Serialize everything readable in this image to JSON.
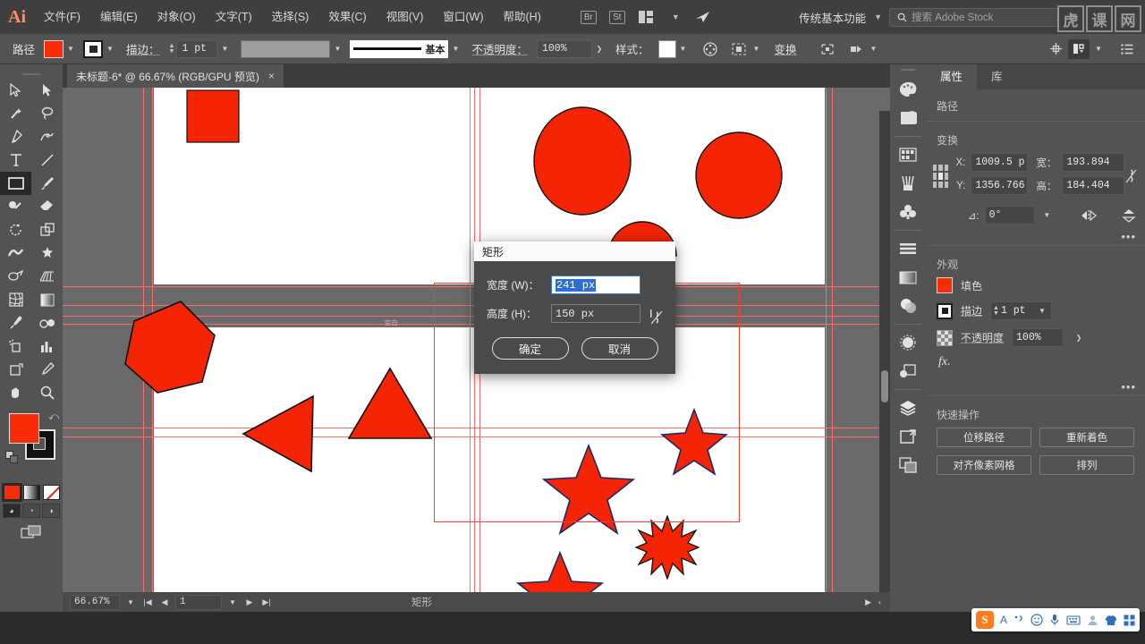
{
  "app": {
    "name": "Adobe Illustrator",
    "logo": "Ai",
    "workspace": "传统基本功能",
    "search_placeholder": "搜索 Adobe Stock"
  },
  "menubar": {
    "items": [
      {
        "label": "文件(F)",
        "name": "menu-file"
      },
      {
        "label": "编辑(E)",
        "name": "menu-edit"
      },
      {
        "label": "对象(O)",
        "name": "menu-object"
      },
      {
        "label": "文字(T)",
        "name": "menu-type"
      },
      {
        "label": "选择(S)",
        "name": "menu-select"
      },
      {
        "label": "效果(C)",
        "name": "menu-effect"
      },
      {
        "label": "视图(V)",
        "name": "menu-view"
      },
      {
        "label": "窗口(W)",
        "name": "menu-window"
      },
      {
        "label": "帮助(H)",
        "name": "menu-help"
      }
    ],
    "bridge": "Br",
    "stock": "St",
    "watermark": [
      "虎",
      "课",
      "网"
    ]
  },
  "controlbar": {
    "path_label": "路径",
    "fill_color": "#fa2b07",
    "stroke_label": "描边：",
    "stroke_weight": "1 pt",
    "stroke_profile": "基本",
    "opacity_label": "不透明度：",
    "opacity_value": "100%",
    "style_label": "样式：",
    "transform_label": "变换",
    "align_icon": "align-icon",
    "isolate_icon": "isolate-icon"
  },
  "toolbar": {
    "tools": [
      {
        "name": "selection-tool",
        "label": "选择工具"
      },
      {
        "name": "direct-selection-tool",
        "label": "直接选择工具"
      },
      {
        "name": "magic-wand-tool",
        "label": "魔棒工具"
      },
      {
        "name": "lasso-tool",
        "label": "套索工具"
      },
      {
        "name": "pen-tool",
        "label": "钢笔工具"
      },
      {
        "name": "curvature-tool",
        "label": "曲率工具"
      },
      {
        "name": "type-tool",
        "label": "文字工具"
      },
      {
        "name": "line-segment-tool",
        "label": "直线段工具"
      },
      {
        "name": "rectangle-tool",
        "label": "矩形工具",
        "selected": true
      },
      {
        "name": "paintbrush-tool",
        "label": "画笔工具"
      },
      {
        "name": "shaper-tool",
        "label": "Shaper 工具"
      },
      {
        "name": "eraser-tool",
        "label": "橡皮擦工具"
      },
      {
        "name": "rotate-tool",
        "label": "旋转工具"
      },
      {
        "name": "scale-tool",
        "label": "比例缩放工具"
      },
      {
        "name": "width-tool",
        "label": "宽度工具"
      },
      {
        "name": "free-transform-tool",
        "label": "自由变换工具"
      },
      {
        "name": "shape-builder-tool",
        "label": "形状生成器工具"
      },
      {
        "name": "perspective-grid-tool",
        "label": "透视网格工具"
      },
      {
        "name": "mesh-tool",
        "label": "网格工具"
      },
      {
        "name": "gradient-tool",
        "label": "渐变工具"
      },
      {
        "name": "eyedropper-tool",
        "label": "吸管工具"
      },
      {
        "name": "blend-tool",
        "label": "混合工具"
      },
      {
        "name": "symbol-sprayer-tool",
        "label": "符号喷枪工具"
      },
      {
        "name": "column-graph-tool",
        "label": "柱形图工具"
      },
      {
        "name": "artboard-tool",
        "label": "画板工具"
      },
      {
        "name": "slice-tool",
        "label": "切片工具"
      },
      {
        "name": "hand-tool",
        "label": "抓手工具"
      },
      {
        "name": "zoom-tool",
        "label": "缩放工具"
      }
    ],
    "fill_color": "#fa2b07",
    "stroke_color": "#111111"
  },
  "document": {
    "tab_title": "未标题-6* @ 66.67% (RGB/GPU 预览)",
    "close_label": "×",
    "canvas_note": "空白"
  },
  "dialog": {
    "title": "矩形",
    "width_label": "宽度 (W)：",
    "width_value": "241 px",
    "height_label": "高度 (H)：",
    "height_value": "150 px",
    "link_icon": "link-broken-icon",
    "ok_label": "确定",
    "cancel_label": "取消"
  },
  "properties": {
    "tabs": [
      {
        "label": "属性",
        "name": "tab-properties",
        "active": true
      },
      {
        "label": "库",
        "name": "tab-libraries",
        "active": false
      }
    ],
    "object_type": "路径",
    "transform": {
      "title": "变换",
      "x_label": "X:",
      "x_value": "1009.5 p",
      "y_label": "Y:",
      "y_value": "1356.766",
      "w_label": "宽：",
      "w_value": "193.894",
      "h_label": "高：",
      "h_value": "184.404",
      "angle_label": "⊿:",
      "angle_value": "0°",
      "flip_h_icon": "flip-horizontal-icon",
      "flip_v_icon": "flip-vertical-icon",
      "link_icon": "link-broken-icon"
    },
    "appearance": {
      "title": "外观",
      "fill_label": "填色",
      "fill_color": "#fa2b07",
      "stroke_label": "描边",
      "stroke_weight": "1 pt",
      "opacity_label": "不透明度",
      "opacity_value": "100%",
      "fx_label": "fx."
    },
    "quick_actions": {
      "title": "快速操作",
      "buttons": [
        {
          "label": "位移路径",
          "name": "qa-offset-path"
        },
        {
          "label": "重新着色",
          "name": "qa-recolor"
        },
        {
          "label": "对齐像素网格",
          "name": "qa-align-pixel-grid"
        },
        {
          "label": "排列",
          "name": "qa-arrange"
        }
      ]
    }
  },
  "statusbar": {
    "zoom": "66.67%",
    "page": "1",
    "tool_name": "矩形"
  },
  "canvas_shapes": [
    {
      "name": "square",
      "type": "rect"
    },
    {
      "name": "ellipse",
      "type": "ellipse"
    },
    {
      "name": "circle",
      "type": "circle"
    },
    {
      "name": "half-circle",
      "type": "circle"
    },
    {
      "name": "hexagon",
      "type": "polygon"
    },
    {
      "name": "triangle-left",
      "type": "triangle"
    },
    {
      "name": "triangle-up",
      "type": "triangle"
    },
    {
      "name": "star-5-top",
      "type": "star"
    },
    {
      "name": "star-5-mid",
      "type": "star"
    },
    {
      "name": "star-5-bottom",
      "type": "star"
    },
    {
      "name": "burst-12",
      "type": "star"
    }
  ],
  "ime": {
    "logo": "S",
    "items": [
      "A",
      "简",
      "笑脸",
      "麦克风",
      "键盘",
      "用户",
      "皮肤",
      "工具箱"
    ]
  }
}
